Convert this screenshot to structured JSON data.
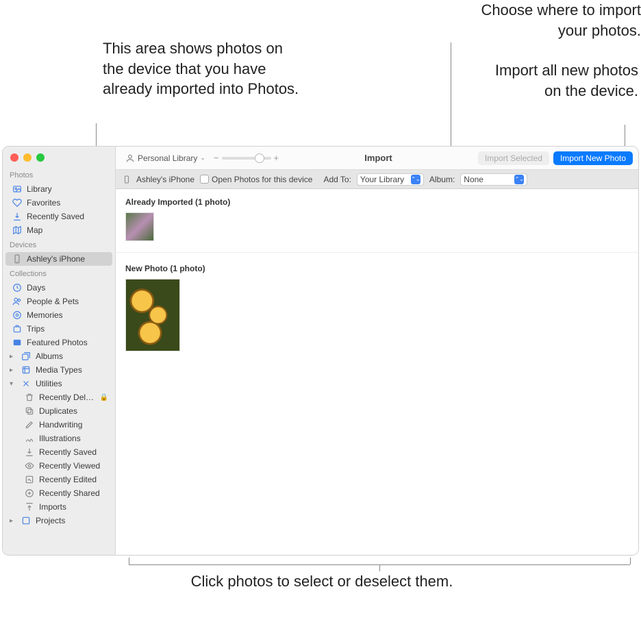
{
  "callouts": {
    "already_imported": "This area shows photos on the device that you have already imported into Photos.",
    "choose_where": "Choose where to import your photos.",
    "import_all": "Import all new photos on the device.",
    "click_select": "Click photos to select or deselect them."
  },
  "toolbar": {
    "library_selector": "Personal Library",
    "title": "Import",
    "import_selected": "Import Selected",
    "import_new": "Import New Photo"
  },
  "subbar": {
    "device_name": "Ashley's iPhone",
    "open_photos_label": "Open Photos for this device",
    "add_to_label": "Add To:",
    "add_to_value": "Your Library",
    "album_label": "Album:",
    "album_value": "None"
  },
  "sections": {
    "already_header": "Already Imported (1 photo)",
    "new_header": "New Photo (1 photo)"
  },
  "sidebar": {
    "group_photos": "Photos",
    "library": "Library",
    "favorites": "Favorites",
    "recently_saved": "Recently Saved",
    "map": "Map",
    "group_devices": "Devices",
    "device_item": "Ashley's iPhone",
    "group_collections": "Collections",
    "days": "Days",
    "people_pets": "People & Pets",
    "memories": "Memories",
    "trips": "Trips",
    "featured_photos": "Featured Photos",
    "albums": "Albums",
    "media_types": "Media Types",
    "utilities": "Utilities",
    "recently_deleted": "Recently Deleted",
    "duplicates": "Duplicates",
    "handwriting": "Handwriting",
    "illustrations": "Illustrations",
    "recently_saved2": "Recently Saved",
    "recently_viewed": "Recently Viewed",
    "recently_edited": "Recently Edited",
    "recently_shared": "Recently Shared",
    "imports": "Imports",
    "projects": "Projects"
  }
}
